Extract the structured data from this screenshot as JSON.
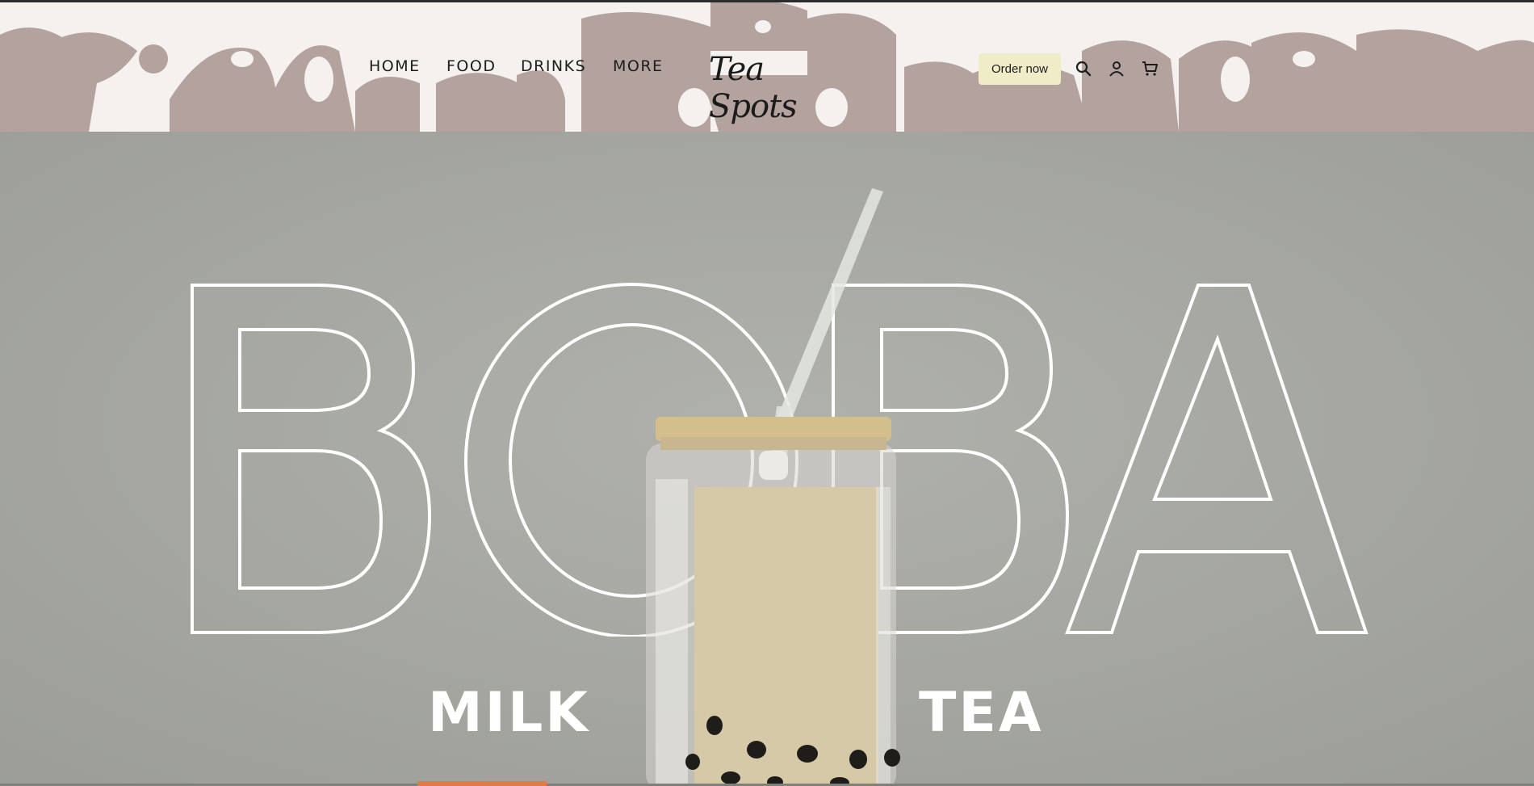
{
  "header": {
    "nav": [
      {
        "label": "HOME"
      },
      {
        "label": "FOOD"
      },
      {
        "label": "DRINKS"
      },
      {
        "label": "MORE"
      }
    ],
    "logo_text": "Tea Spots",
    "order_button": "Order now",
    "icons": [
      "search-icon",
      "account-icon",
      "cart-icon"
    ]
  },
  "hero": {
    "headline": "BOBA",
    "word_left": "MILK",
    "word_right": "TEA"
  },
  "colors": {
    "header_bg": "#f4f1ef",
    "doodle": "#b3a29e",
    "order_button_bg": "#f1ecc8",
    "hero_bg": "#a9aaa4",
    "accent": "#e07a4a"
  }
}
